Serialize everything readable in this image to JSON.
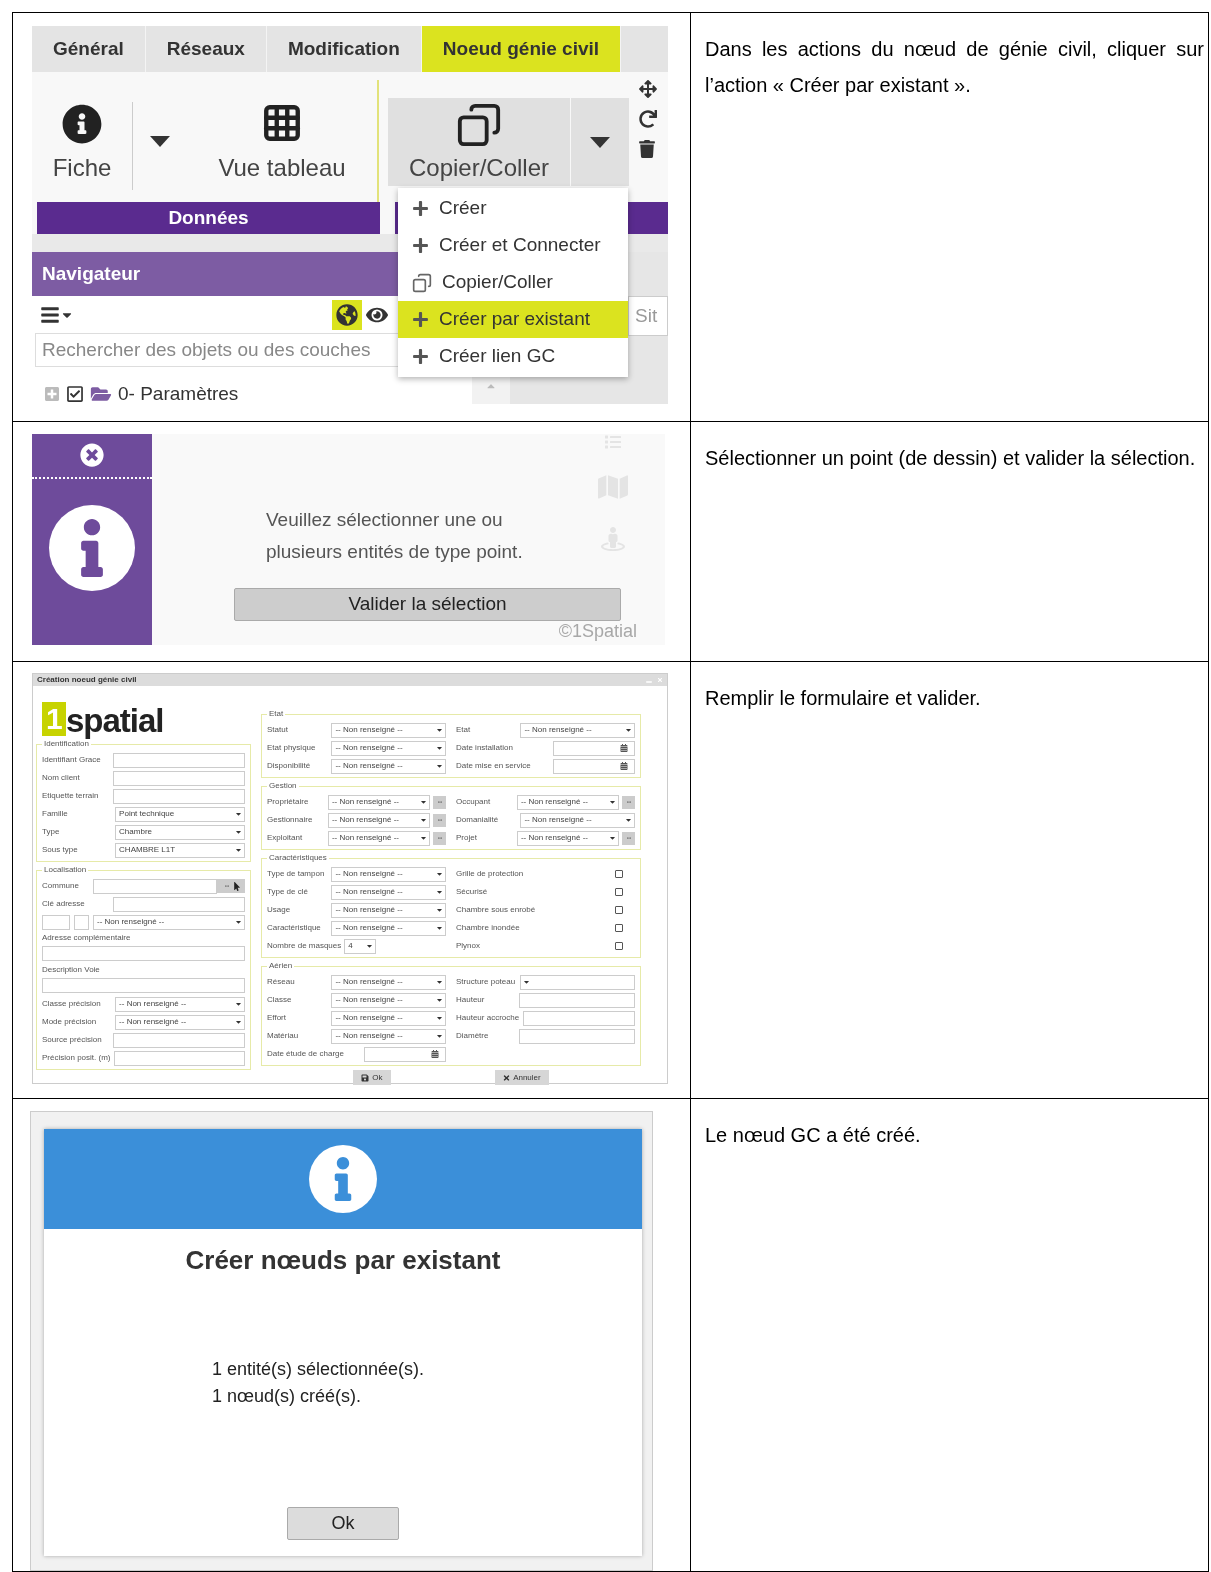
{
  "table": {
    "rows": [
      {
        "screen": {
          "kind": "ribbon",
          "tabs": [
            {
              "label": "Général",
              "selected": false
            },
            {
              "label": "Réseaux",
              "selected": false
            },
            {
              "label": "Modification",
              "selected": false
            },
            {
              "label": "Noeud génie civil",
              "selected": true
            }
          ],
          "buttons": [
            {
              "label": "Fiche"
            },
            {
              "label": "Vue tableau"
            },
            {
              "label": "Copier/Coller"
            }
          ],
          "group": "Données",
          "navigator": {
            "title": "Navigateur",
            "toggles": [
              {
                "selected": true
              },
              {
                "selected": false
              }
            ],
            "search": {
              "placeholder": "Rechercher des objets ou des couches"
            },
            "tree": [
              {
                "label": "0- Paramètres",
                "checked": true,
                "expanded": false
              }
            ]
          },
          "side_field": {
            "placeholder": "Sit"
          },
          "menu": [
            {
              "kind": "add",
              "label": "Créer",
              "selected": false
            },
            {
              "kind": "add",
              "label": "Créer et Connecter",
              "selected": false
            },
            {
              "kind": "copy",
              "label": "Copier/Coller",
              "selected": false
            },
            {
              "kind": "add",
              "label": "Créer par existant",
              "selected": true
            },
            {
              "kind": "add",
              "label": "Créer lien GC",
              "selected": false
            }
          ]
        },
        "instruction": "Dans les actions du nœud de génie civil, cliquer sur l’action « Créer par existant »."
      },
      {
        "screen": {
          "kind": "selection",
          "message": "Veuillez sélectionner une ou plusieurs entités de type point.",
          "button": "Valider la sélection",
          "attribution": "©1Spatial"
        },
        "instruction": "Sélectionner un point (de dessin) et valider la sélection."
      },
      {
        "screen": {
          "kind": "form",
          "title": "Création noeud génie civil",
          "logo": {
            "digit": "1",
            "word": "spatial"
          },
          "left": [
            {
              "legend": "Identification",
              "columns": [
                [
                  {
                    "kind": "text",
                    "label": "Identifiant Grace"
                  },
                  {
                    "kind": "text",
                    "label": "Nom client"
                  },
                  {
                    "kind": "text",
                    "label": "Etiquette terrain"
                  },
                  {
                    "kind": "select",
                    "label": "Famille",
                    "value": "Point technique"
                  },
                  {
                    "kind": "select",
                    "label": "Type",
                    "value": "Chambre"
                  },
                  {
                    "kind": "select",
                    "label": "Sous type",
                    "value": "CHAMBRE L1T"
                  }
                ]
              ]
            },
            {
              "legend": "Localisation",
              "columns": [
                [
                  {
                    "kind": "lookup",
                    "label": "Commune"
                  },
                  {
                    "kind": "text",
                    "label": "Clé adresse"
                  },
                  {
                    "kind": "address",
                    "value": "-- Non renseigné --"
                  },
                  {
                    "kind": "text_block",
                    "label": "Adresse complémentaire"
                  },
                  {
                    "kind": "text_block",
                    "label": "Description Voie"
                  },
                  {
                    "kind": "select",
                    "label": "Classe précision",
                    "value": "-- Non renseigné --"
                  },
                  {
                    "kind": "select",
                    "label": "Mode précision",
                    "value": "-- Non renseigné --"
                  },
                  {
                    "kind": "text",
                    "label": "Source précision"
                  },
                  {
                    "kind": "text",
                    "label": "Précision posit. (m)"
                  }
                ]
              ]
            }
          ],
          "right": [
            {
              "legend": "Etat",
              "columns": [
                [
                  {
                    "kind": "select",
                    "label": "Statut",
                    "value": "-- Non renseigné --"
                  },
                  {
                    "kind": "select",
                    "label": "Etat physique",
                    "value": "-- Non renseigné --"
                  },
                  {
                    "kind": "select",
                    "label": "Disponibilité",
                    "value": "-- Non renseigné --"
                  }
                ],
                [
                  {
                    "kind": "select",
                    "label": "Etat",
                    "value": "-- Non renseigné --"
                  },
                  {
                    "kind": "date",
                    "label": "Date installation"
                  },
                  {
                    "kind": "date",
                    "label": "Date mise en service"
                  }
                ]
              ]
            },
            {
              "legend": "Gestion",
              "columns": [
                [
                  {
                    "kind": "select_more",
                    "label": "Propriétaire",
                    "value": "-- Non renseigné --"
                  },
                  {
                    "kind": "select_more",
                    "label": "Gestionnaire",
                    "value": "-- Non renseigné --"
                  },
                  {
                    "kind": "select_more",
                    "label": "Exploitant",
                    "value": "-- Non renseigné --"
                  }
                ],
                [
                  {
                    "kind": "select_more",
                    "label": "Occupant",
                    "value": "-- Non renseigné --"
                  },
                  {
                    "kind": "select",
                    "label": "Domanialité",
                    "value": "-- Non renseigné --"
                  },
                  {
                    "kind": "select_more",
                    "label": "Projet",
                    "value": "-- Non renseigné --"
                  }
                ]
              ]
            },
            {
              "legend": "Caractéristiques",
              "columns": [
                [
                  {
                    "kind": "select",
                    "label": "Type de tampon",
                    "value": "-- Non renseigné --"
                  },
                  {
                    "kind": "select",
                    "label": "Type de clé",
                    "value": "-- Non renseigné --"
                  },
                  {
                    "kind": "select",
                    "label": "Usage",
                    "value": "-- Non renseigné --"
                  },
                  {
                    "kind": "select",
                    "label": "Caractéristique",
                    "value": "-- Non renseigné --"
                  },
                  {
                    "kind": "select_small",
                    "label": "Nombre de masques",
                    "value": "4"
                  }
                ],
                [
                  {
                    "kind": "checkbox",
                    "label": "Grille de protection",
                    "checked": false
                  },
                  {
                    "kind": "checkbox",
                    "label": "Sécurisé",
                    "checked": false
                  },
                  {
                    "kind": "checkbox",
                    "label": "Chambre sous enrobé",
                    "checked": false
                  },
                  {
                    "kind": "checkbox",
                    "label": "Chambre inondée",
                    "checked": false
                  },
                  {
                    "kind": "checkbox",
                    "label": "Plynox",
                    "checked": false
                  }
                ]
              ]
            },
            {
              "legend": "Aérien",
              "columns": [
                [
                  {
                    "kind": "select",
                    "label": "Réseau",
                    "value": "-- Non renseigné --"
                  },
                  {
                    "kind": "select",
                    "label": "Classe",
                    "value": "-- Non renseigné --"
                  },
                  {
                    "kind": "select",
                    "label": "Effort",
                    "value": "-- Non renseigné --"
                  },
                  {
                    "kind": "select",
                    "label": "Matériau",
                    "value": "-- Non renseigné --"
                  },
                  {
                    "kind": "date",
                    "label": "Date étude de charge"
                  }
                ],
                [
                  {
                    "kind": "select",
                    "label": "Structure poteau"
                  },
                  {
                    "kind": "text",
                    "label": "Hauteur"
                  },
                  {
                    "kind": "text",
                    "label": "Hauteur accroche"
                  },
                  {
                    "kind": "text",
                    "label": "Diamètre"
                  }
                ]
              ]
            }
          ],
          "buttons": [
            {
              "kind": "save",
              "label": "Ok"
            },
            {
              "kind": "cancel",
              "label": "Annuler"
            }
          ]
        },
        "instruction": "Remplir le formulaire et valider."
      },
      {
        "screen": {
          "kind": "result",
          "title": "Créer nœuds par existant",
          "messages": [
            "1 entité(s) sélectionnée(s).",
            "1 nœud(s) créé(s)."
          ],
          "button": "Ok"
        },
        "instruction": "Le nœud GC a été créé."
      }
    ]
  }
}
